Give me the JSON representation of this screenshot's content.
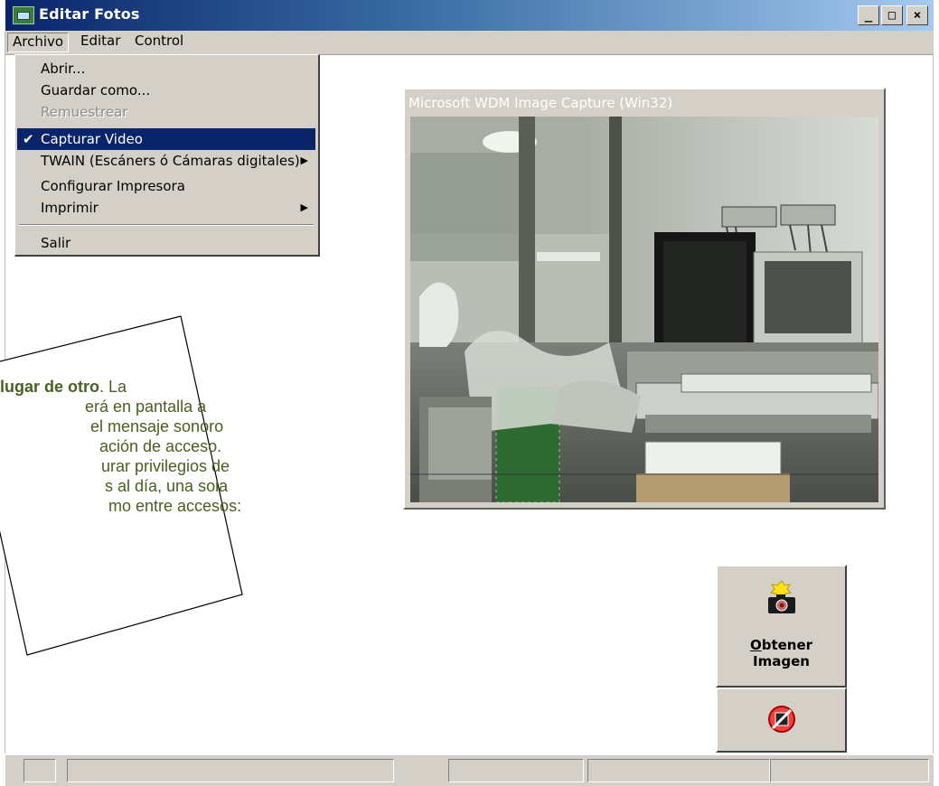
{
  "window": {
    "title": "Editar Fotos",
    "minimize_glyph": "_",
    "maximize_glyph": "□",
    "close_glyph": "×"
  },
  "menubar": {
    "items": [
      "Archivo",
      "Editar",
      "Control"
    ]
  },
  "archivo_menu": {
    "items": [
      {
        "label": "Abrir...",
        "enabled": true,
        "checked": false,
        "submenu": false
      },
      {
        "label": "Guardar como...",
        "enabled": true,
        "checked": false,
        "submenu": false
      },
      {
        "label": "Remuestrear",
        "enabled": false,
        "checked": false,
        "submenu": false
      },
      {
        "label": "Capturar Video",
        "enabled": true,
        "checked": true,
        "submenu": false,
        "highlighted": true
      },
      {
        "label": "TWAIN (Escáners ó Cámaras digitales)",
        "enabled": true,
        "checked": false,
        "submenu": true
      },
      {
        "label": "Configurar Impresora",
        "enabled": true,
        "checked": false,
        "submenu": false
      },
      {
        "label": "Imprimir",
        "enabled": true,
        "checked": false,
        "submenu": true
      },
      {
        "label": "Salir",
        "enabled": true,
        "checked": false,
        "submenu": false
      }
    ],
    "check_glyph": "✔",
    "arrow_glyph": "▶"
  },
  "capture": {
    "title": "Microsoft WDM Image Capture (Win32)"
  },
  "callout": {
    "lines": [
      {
        "bold": "lugar de otro",
        "text": ". La"
      },
      {
        "bold": "",
        "text": "erá en pantalla a"
      },
      {
        "bold": "",
        "text": "el mensaje sonoro"
      },
      {
        "bold": "",
        "text": "ación de acceso."
      },
      {
        "bold": "",
        "text": "urar privilegios de"
      },
      {
        "bold": "",
        "text": "s al día, una sola"
      },
      {
        "bold": "",
        "text": "mo entre accesos:"
      }
    ]
  },
  "buttons": {
    "obtener_underlined": "O",
    "obtener_rest": "btener",
    "obtener_line2": "Imagen",
    "camera_icon": "camera-icon",
    "stop_icon": "no-video-icon"
  },
  "colors": {
    "titlebar_start": "#0a246a",
    "titlebar_end": "#a6caf0",
    "menu_highlight": "#0a246a",
    "callout_text": "#4a5f1f",
    "face": "#d4d0c8"
  }
}
